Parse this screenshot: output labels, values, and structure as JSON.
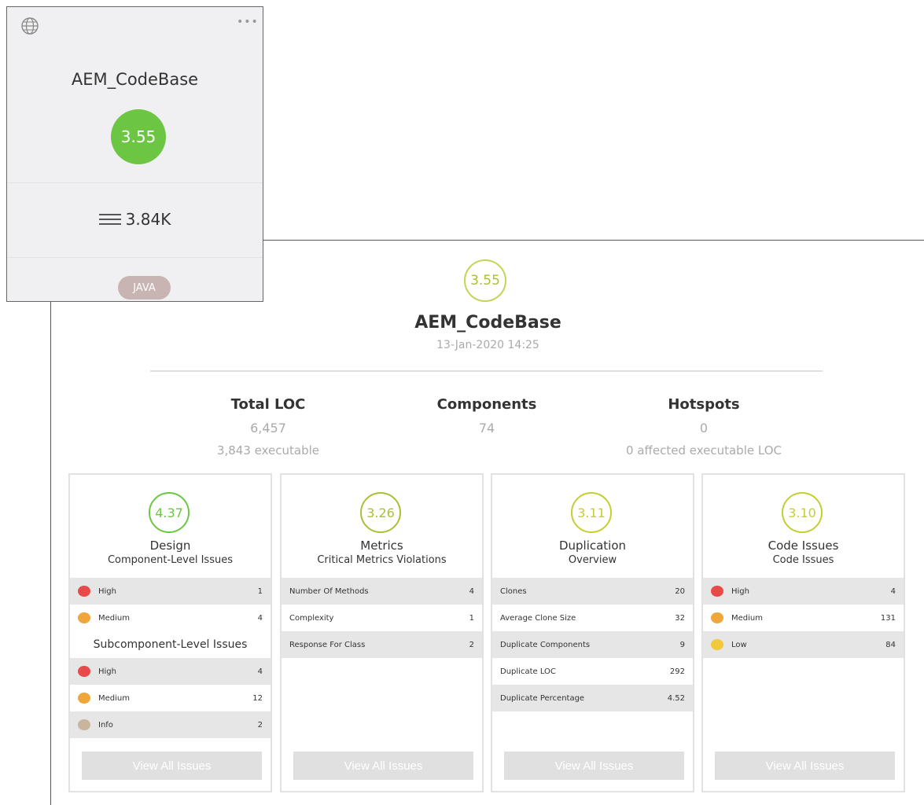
{
  "tile": {
    "name": "AEM_CodeBase",
    "score": "3.55",
    "loc": "3.84K",
    "language": "JAVA",
    "globe_icon": "globe-icon",
    "more_icon": "more-icon",
    "score_color": "#6cc644"
  },
  "header": {
    "score": "3.55",
    "title": "AEM_CodeBase",
    "date": "13-Jan-2020 14:25",
    "score_color": "#a9c036"
  },
  "stats": [
    {
      "label": "Total LOC",
      "value": "6,457",
      "sub": "3,843 executable"
    },
    {
      "label": "Components",
      "value": "74",
      "sub": ""
    },
    {
      "label": "Hotspots",
      "value": "0",
      "sub": "0 affected executable LOC"
    }
  ],
  "cards": {
    "design": {
      "score": "4.37",
      "title": "Design",
      "subtitle": "Component-Level Issues",
      "score_color": "#6cc644",
      "rows": [
        {
          "label": "High",
          "value": "1",
          "dot": "#e84a4a"
        },
        {
          "label": "Medium",
          "value": "4",
          "dot": "#f0a63a"
        }
      ],
      "subheading": "Subcomponent-Level Issues",
      "rows2": [
        {
          "label": "High",
          "value": "4",
          "dot": "#e84a4a"
        },
        {
          "label": "Medium",
          "value": "12",
          "dot": "#f0a63a"
        },
        {
          "label": "Info",
          "value": "2",
          "dot": "#c9b49e"
        }
      ],
      "button": "View All Issues"
    },
    "metrics": {
      "score": "3.26",
      "title": "Metrics",
      "subtitle": "Critical Metrics Violations",
      "score_color": "#a9c036",
      "rows": [
        {
          "label": "Number Of Methods",
          "value": "4"
        },
        {
          "label": "Complexity",
          "value": "1"
        },
        {
          "label": "Response For Class",
          "value": "2"
        }
      ],
      "button": "View All Issues"
    },
    "duplication": {
      "score": "3.11",
      "title": "Duplication",
      "subtitle": "Overview",
      "score_color": "#c4cf2f",
      "rows": [
        {
          "label": "Clones",
          "value": "20"
        },
        {
          "label": "Average Clone Size",
          "value": "32"
        },
        {
          "label": "Duplicate Components",
          "value": "9"
        },
        {
          "label": "Duplicate LOC",
          "value": "292"
        },
        {
          "label": "Duplicate Percentage",
          "value": "4.52"
        }
      ],
      "button": "View All Issues"
    },
    "code_issues": {
      "score": "3.10",
      "title": "Code Issues",
      "subtitle": "Code Issues",
      "score_color": "#c4cf2f",
      "rows": [
        {
          "label": "High",
          "value": "4",
          "dot": "#e84a4a"
        },
        {
          "label": "Medium",
          "value": "131",
          "dot": "#f0a63a"
        },
        {
          "label": "Low",
          "value": "84",
          "dot": "#f2c93a"
        }
      ],
      "button": "View All Issues"
    }
  }
}
